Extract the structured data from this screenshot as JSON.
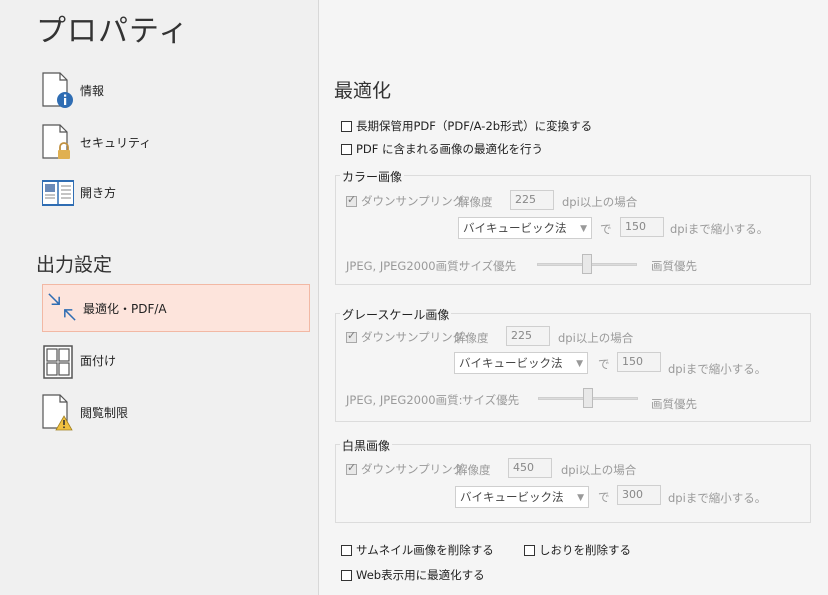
{
  "app": {
    "title": "プロパティ"
  },
  "sidebar": {
    "items": [
      {
        "label": "情報",
        "icon": "document-info-icon"
      },
      {
        "label": "セキュリティ",
        "icon": "document-lock-icon"
      },
      {
        "label": "開き方",
        "icon": "open-book-icon"
      }
    ],
    "section_title": "出力設定",
    "output_items": [
      {
        "label": "最適化・PDF/A",
        "icon": "optimize-arrows-icon",
        "selected": true
      },
      {
        "label": "面付け",
        "icon": "grid-layout-icon"
      },
      {
        "label": "閲覧制限",
        "icon": "document-warning-icon"
      }
    ]
  },
  "main": {
    "heading": "最適化",
    "convert_pdfa_label": "長期保管用PDF（PDF/A-2b形式）に変換する",
    "optimize_images_label": "PDF に含まれる画像の最適化を行う",
    "color": {
      "title": "カラー画像",
      "downsample_label": "ダウンサンプリング:",
      "resolution_label": "解像度",
      "resolution_value": "225",
      "dpi_above_label": "dpi以上の場合",
      "method": "バイキュービック法",
      "de": "で",
      "target_value": "150",
      "dpi_reduce_label": "dpiまで縮小する。",
      "jpeg_label": "JPEG, JPEG2000画質:",
      "size_priority": "サイズ優先",
      "quality_priority": "画質優先",
      "quality_slider": 0.5
    },
    "gray": {
      "title": "グレースケール画像",
      "downsample_label": "ダウンサンプリング:",
      "resolution_label": "解像度",
      "resolution_value": "225",
      "dpi_above_label": "dpi以上の場合",
      "method": "バイキュービック法",
      "de": "で",
      "target_value": "150",
      "dpi_reduce_label": "dpiまで縮小する。",
      "jpeg_label": "JPEG, JPEG2000画質:",
      "size_priority": "サイズ優先",
      "quality_priority": "画質優先",
      "quality_slider": 0.5
    },
    "mono": {
      "title": "白黒画像",
      "downsample_label": "ダウンサンプリング:",
      "resolution_label": "解像度",
      "resolution_value": "450",
      "dpi_above_label": "dpi以上の場合",
      "method": "バイキュービック法",
      "de": "で",
      "target_value": "300",
      "dpi_reduce_label": "dpiまで縮小する。"
    },
    "remove_thumbnails_label": "サムネイル画像を削除する",
    "remove_bookmarks_label": "しおりを削除する",
    "web_optimize_label": "Web表示用に最適化する"
  },
  "colors": {
    "selected_bg": "#fde4dc",
    "selected_border": "#f2b8a4",
    "icon_blue": "#2f6db3",
    "icon_lock": "#e0b050"
  }
}
